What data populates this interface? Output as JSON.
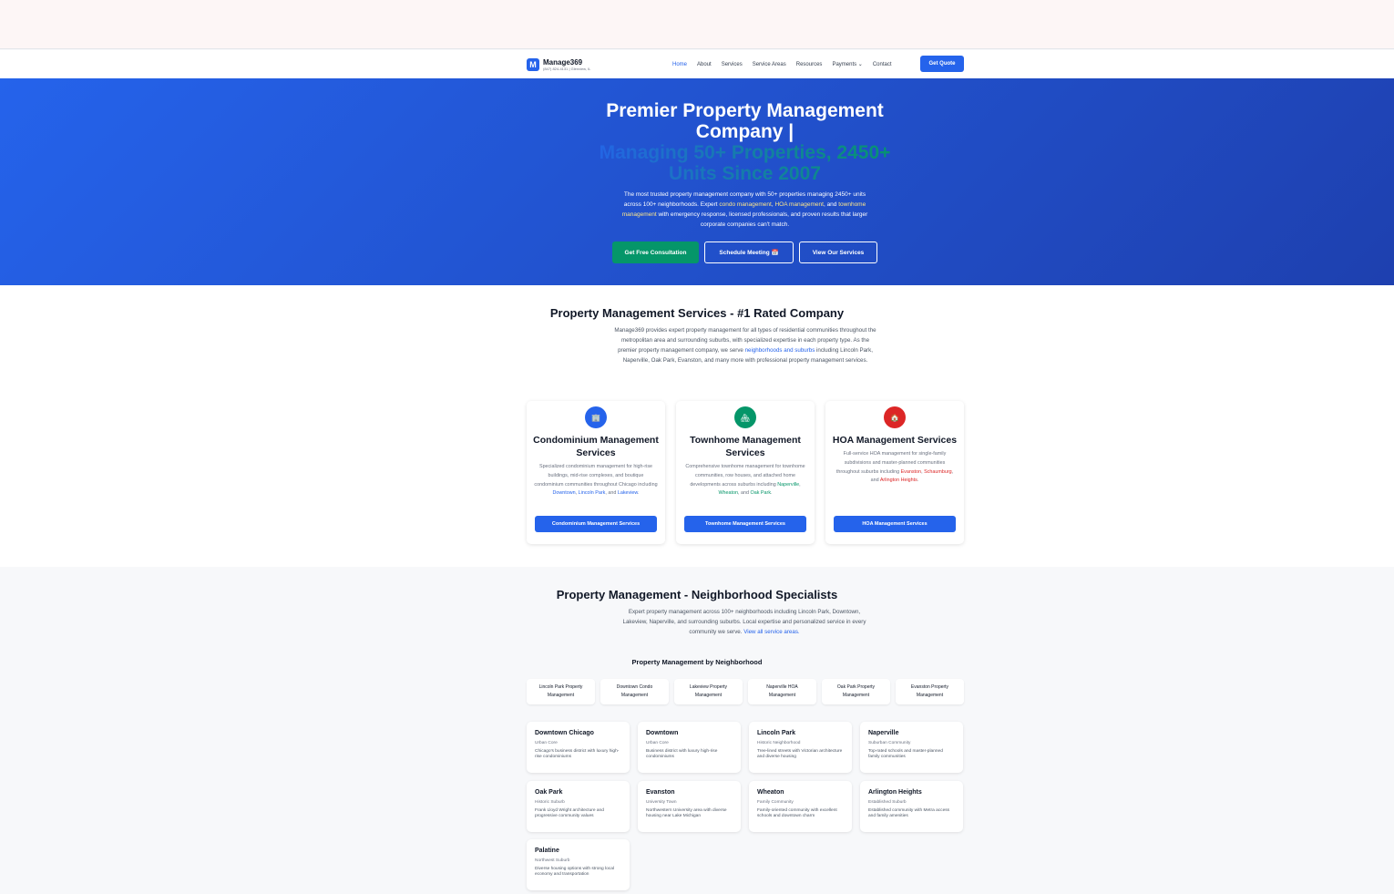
{
  "brand": {
    "logo": "M",
    "name": "Manage369",
    "sub": "(847) 824-4131 | Glenview, IL"
  },
  "nav": {
    "items": [
      "Home",
      "About",
      "Services",
      "Service Areas",
      "Resources",
      "Payments ⌄",
      "Contact"
    ],
    "cta": "Get Quote"
  },
  "hero": {
    "title": "Premier Property Management Company |",
    "highlight": "Managing 50+ Properties, 2450+ Units Since 2007",
    "desc_1": "The most trusted property management company with 50+ properties managing 2450+ units across 100+ neighborhoods. Expert ",
    "desc_kw1": "condo management",
    "desc_2": ", ",
    "desc_kw2": "HOA management",
    "desc_3": ", and ",
    "desc_kw3": "townhome management",
    "desc_4": " with emergency response, licensed professionals, and proven results that larger corporate companies can't match.",
    "btn_consult": "Get Free Consultation",
    "btn_meeting": "Schedule Meeting 📅",
    "btn_services": "View Our Services"
  },
  "services": {
    "title": "Property Management Services - #1 Rated Company",
    "desc_1": "Manage369 provides expert property management for all types of residential communities throughout the metropolitan area and surrounding suburbs, with specialized expertise in each property type. As the premier property management company, we serve ",
    "desc_link": "neighborhoods and suburbs",
    "desc_2": " including Lincoln Park, Naperville, Oak Park, Evanston, and many more with professional property management services.",
    "cards": [
      {
        "icon": "🏢",
        "color": "#2563eb",
        "title": "Condominium Management Services",
        "desc": "Specialized condominium management for high-rise buildings, mid-rise complexes, and boutique condominium communities throughout Chicago including ",
        "links": [
          "Downtown",
          "Lincoln Park",
          "Lakeview"
        ],
        "btn": "Condominium Management Services"
      },
      {
        "icon": "🏘",
        "color": "#059669",
        "title": "Townhome Management Services",
        "desc": "Comprehensive townhome management for townhome communities, row houses, and attached home developments across suburbs including ",
        "links": [
          "Naperville",
          "Wheaton",
          "Oak Park"
        ],
        "btn": "Townhome Management Services"
      },
      {
        "icon": "🏠",
        "color": "#dc2626",
        "title": "HOA Management Services",
        "desc": "Full-service HOA management for single-family subdivisions and master-planned communities throughout suburbs including ",
        "links": [
          "Evanston",
          "Schaumburg",
          "Arlington Heights"
        ],
        "btn": "HOA Management Services"
      }
    ]
  },
  "neighborhoods": {
    "title": "Property Management - Neighborhood Specialists",
    "desc_1": "Expert property management across 100+ neighborhoods including Lincoln Park, Downtown, Lakeview, Naperville, and surrounding suburbs. Local expertise and personalized service in every community we serve. ",
    "desc_link": "View all service areas.",
    "subtitle": "Property Management by Neighborhood",
    "tabs": [
      "Lincoln Park Property Management",
      "Downtown Condo Management",
      "Lakeview Property Management",
      "Naperville HOA Management",
      "Oak Park Property Management",
      "Evanston Property Management"
    ],
    "areas": [
      {
        "name": "Downtown Chicago",
        "type": "Urban Core",
        "desc": "Chicago's business district with luxury high-rise condominiums"
      },
      {
        "name": "Downtown",
        "type": "Urban Core",
        "desc": "Business district with luxury high-rise condominiums"
      },
      {
        "name": "Lincoln Park",
        "type": "Historic Neighborhood",
        "desc": "Tree-lined streets with Victorian architecture and diverse housing"
      },
      {
        "name": "Naperville",
        "type": "Suburban Community",
        "desc": "Top-rated schools and master-planned family communities"
      },
      {
        "name": "Oak Park",
        "type": "Historic Suburb",
        "desc": "Frank Lloyd Wright architecture and progressive community values"
      },
      {
        "name": "Evanston",
        "type": "University Town",
        "desc": "Northwestern University area with diverse housing near Lake Michigan"
      },
      {
        "name": "Wheaton",
        "type": "Family Community",
        "desc": "Family-oriented community with excellent schools and downtown charm"
      },
      {
        "name": "Arlington Heights",
        "type": "Established Suburb",
        "desc": "Established community with Metra access and family amenities"
      },
      {
        "name": "Palatine",
        "type": "Northwest Suburb",
        "desc": "Diverse housing options with strong local economy and transportation"
      }
    ]
  }
}
